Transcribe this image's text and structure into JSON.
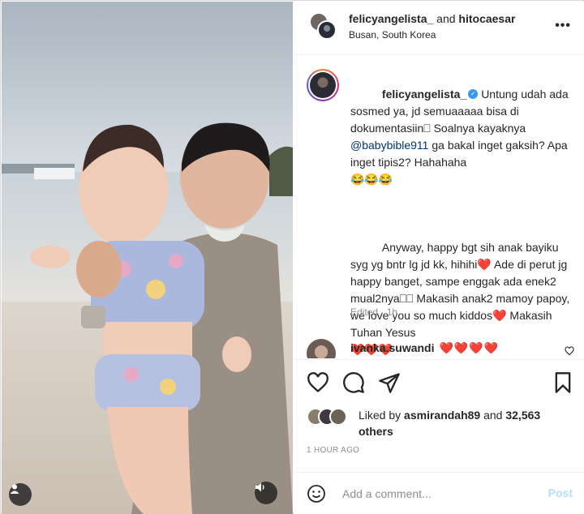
{
  "header": {
    "username": "felicyangelista_",
    "and_text": "and",
    "collaborator": "hitocaesar",
    "location": "Busan, South Korea",
    "more_icon": "more-horizontal-icon",
    "more_label": "•••"
  },
  "caption": {
    "username": "felicyangelista_",
    "verified_icon": "verified-badge-icon",
    "verified_glyph": "✓",
    "line1_a": "Untung udah ada sosmed ya, jd semuaaaaa bisa di dokumentasiin",
    "line1_b": " Soalnya kayaknya ",
    "mention": "@babybible911",
    "line1_c": " ga bakal inget gaksih? Apa inget tipis2? Hahahaha",
    "line1_emoji": "😂😂😂",
    "para2_a": "Anyway, happy bgt sih anak bayiku syg yg bntr lg jd kk, hihihi",
    "para2_b": " Ade di perut jg happy banget, sampe enggak ada enek2 mual2nya",
    "para2_c": " Makasih anak2 mamoy papoy, we love you so much kiddos",
    "para2_d": " Makasih Tuhan Yesus",
    "hearts_inline": "❤️",
    "hearts_end": "❤️❤️❤️",
    "boxes": "⎕",
    "boxes2": "⎕⎕",
    "edited": "Edited · 1h"
  },
  "comment2": {
    "username": "ivanka.suwandi",
    "text": "❤️❤️❤️❤️",
    "like_icon": "heart-outline-icon"
  },
  "actions": {
    "like_icon": "heart-outline-icon",
    "comment_icon": "comment-bubble-icon",
    "share_icon": "paper-plane-icon",
    "save_icon": "bookmark-icon"
  },
  "likes": {
    "prefix": "Liked by ",
    "user": "asmirandah89",
    "and": " and ",
    "count": "32,563 others"
  },
  "timestamp": "1 HOUR AGO",
  "add_comment": {
    "placeholder": "Add a comment...",
    "post_label": "Post",
    "emoji_icon": "smiley-face-icon"
  },
  "media": {
    "user_tag_icon": "user-tag-icon",
    "audio_icon": "speaker-icon"
  }
}
